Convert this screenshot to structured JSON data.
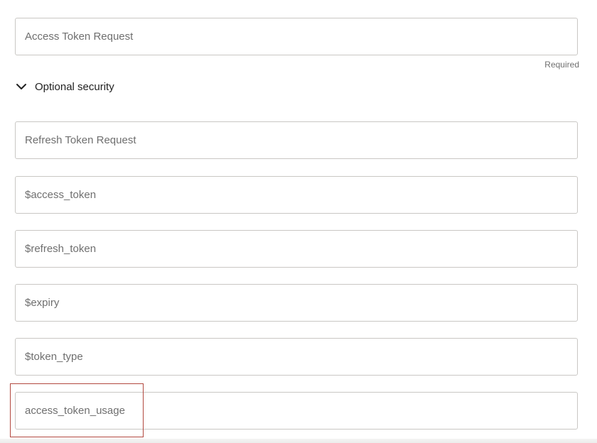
{
  "access_token_field": {
    "value": "",
    "placeholder": "Access Token Request",
    "helper": "Required"
  },
  "optional_security": {
    "label": "Optional security",
    "expanded": true,
    "icon": "chevron-down-icon"
  },
  "optional_fields": [
    {
      "value": "",
      "placeholder": "Refresh Token Request"
    },
    {
      "value": "",
      "placeholder": "$access_token"
    },
    {
      "value": "",
      "placeholder": "$refresh_token"
    },
    {
      "value": "",
      "placeholder": "$expiry"
    },
    {
      "value": "",
      "placeholder": "$token_type"
    },
    {
      "value": "",
      "placeholder": "access_token_usage"
    }
  ],
  "colors": {
    "field_border": "#c9c7c4",
    "placeholder": "#6f6f6f",
    "highlight_border": "#b2483f"
  }
}
